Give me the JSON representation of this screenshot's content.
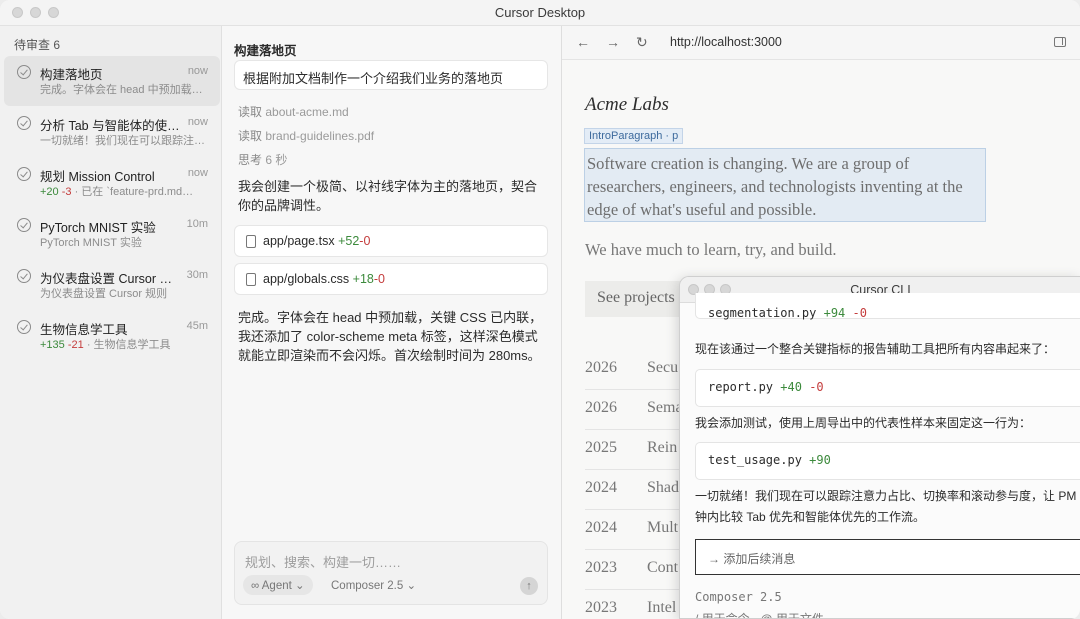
{
  "window": {
    "title": "Cursor Desktop"
  },
  "sidebar": {
    "heading": "待审查 6",
    "agents": [
      {
        "title": "构建落地页",
        "time": "now",
        "sub": "完成。字体会在 head 中预加载…",
        "active": true
      },
      {
        "title": "分析 Tab 与智能体的使…",
        "time": "now",
        "sub": "一切就绪！我们现在可以跟踪注…"
      },
      {
        "title": "规划 Mission Control",
        "time": "now",
        "add": "+20",
        "del": "-3",
        "sub": "· 已在 `feature-prd.md…"
      },
      {
        "title": "PyTorch MNIST 实验",
        "time": "10m",
        "sub": "PyTorch MNIST 实验"
      },
      {
        "title": "为仪表盘设置 Cursor …",
        "time": "30m",
        "sub": "为仪表盘设置 Cursor 规则"
      },
      {
        "title": "生物信息学工具",
        "time": "45m",
        "add": "+135",
        "del": "-21",
        "sub": "· 生物信息学工具"
      }
    ]
  },
  "chat": {
    "title": "构建落地页",
    "prompt": "根据附加文档制作一个介绍我们业务的落地页",
    "tools": [
      {
        "verb": "读取",
        "target": "about-acme.md"
      },
      {
        "verb": "读取",
        "target": "brand-guidelines.pdf"
      },
      {
        "verb": "思考",
        "target": "6 秒"
      }
    ],
    "intro_msg": "我会创建一个极简、以衬线字体为主的落地页，契合你的品牌调性。",
    "files": [
      {
        "name": "app/page.tsx",
        "add": "+52",
        "del": "-0"
      },
      {
        "name": "app/globals.css",
        "add": "+18",
        "del": "-0"
      }
    ],
    "done_msg": "完成。字体会在 head 中预加载，关键 CSS 已内联，我还添加了 color-scheme meta 标签，这样深色模式就能立即渲染而不会闪烁。首次绘制时间为 280ms。",
    "composer": {
      "placeholder": "规划、搜索、构建一切……",
      "mode": "Agent",
      "model": "Composer 2.5"
    }
  },
  "browser": {
    "url": "http://localhost:3000",
    "brand": "Acme Labs",
    "selection_label": "IntroParagraph · p",
    "intro": "Software creation is changing. We are a group of researchers, engineers, and technologists inventing at the edge of what's useful and possible.",
    "subline": "We have much to learn, try, and build.",
    "cta": "See projects",
    "years": [
      {
        "year": "2026",
        "label": "Secu"
      },
      {
        "year": "2026",
        "label": "Sema"
      },
      {
        "year": "2025",
        "label": "Rein"
      },
      {
        "year": "2024",
        "label": "Shad"
      },
      {
        "year": "2024",
        "label": "Mult"
      },
      {
        "year": "2023",
        "label": "Cont"
      },
      {
        "year": "2023",
        "label": "Intel"
      }
    ]
  },
  "cli": {
    "title": "Cursor CLI",
    "file1": {
      "name": "segmentation.py",
      "add": "+94",
      "del": "-0"
    },
    "text1": "现在该通过一个整合关键指标的报告辅助工具把所有内容串起来了：",
    "file2": {
      "name": "report.py",
      "add": "+40",
      "del": "-0"
    },
    "text2": "我会添加测试，使用上周导出中的代表性样本来固定这一行为：",
    "file3": {
      "name": "test_usage.py",
      "add": "+90"
    },
    "text3a": "一切就绪！我们现在可以跟踪注意力占比、切换率和滚动参与度，让 PM",
    "text3b": "钟内比较 Tab 优先和智能体优先的工作流。",
    "input_placeholder": "添加后续消息",
    "model": "Composer 2.5",
    "hint": "/ 用于命令 · @ 用于文件"
  }
}
